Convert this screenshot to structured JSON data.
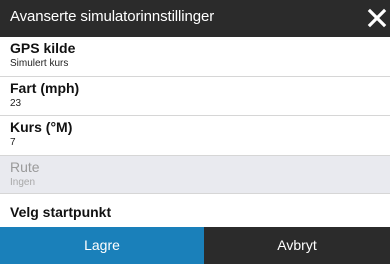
{
  "dialog": {
    "title": "Avanserte simulatorinnstillinger",
    "close_icon": "close-icon"
  },
  "settings": [
    {
      "label": "GPS kilde",
      "value": "Simulert kurs"
    },
    {
      "label": "Fart (mph)",
      "value": "23"
    },
    {
      "label": "Kurs (°M)",
      "value": "7"
    },
    {
      "label": "Rute",
      "value": "Ingen",
      "disabled": true
    },
    {
      "label": "Velg startpunkt"
    }
  ],
  "footer": {
    "save_label": "Lagre",
    "cancel_label": "Avbryt"
  },
  "colors": {
    "titlebar": "#2b2b2b",
    "accent": "#1a80ba",
    "selected_row": "#e9eaef"
  }
}
